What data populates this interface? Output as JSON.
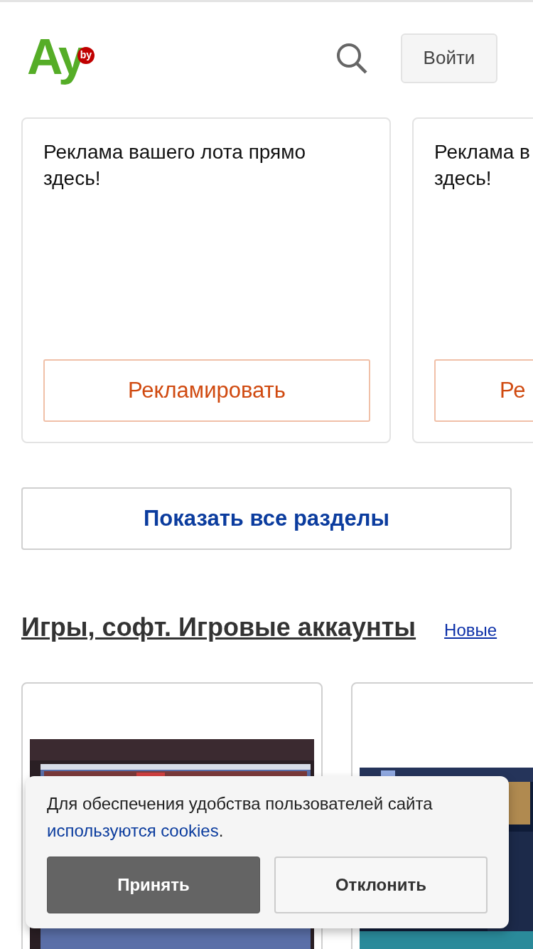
{
  "header": {
    "logo": {
      "main": "Ay",
      "badge": "by"
    },
    "login_button": "Войти"
  },
  "ads": [
    {
      "lines": [
        "Реклама вашего лота прямо",
        "здесь!"
      ],
      "button": "Рекламировать"
    },
    {
      "lines": [
        "Реклама в",
        "здесь!"
      ],
      "button": "Ре"
    }
  ],
  "show_all_button": "Показать все разделы",
  "section": {
    "title": "Игры, софт. Игровые аккаунты",
    "link": "Новые"
  },
  "cookie_banner": {
    "text": "Для обеспечения удобства пользователей сайта",
    "link": "используются cookies",
    "end": ".",
    "accept": "Принять",
    "decline": "Отклонить"
  }
}
